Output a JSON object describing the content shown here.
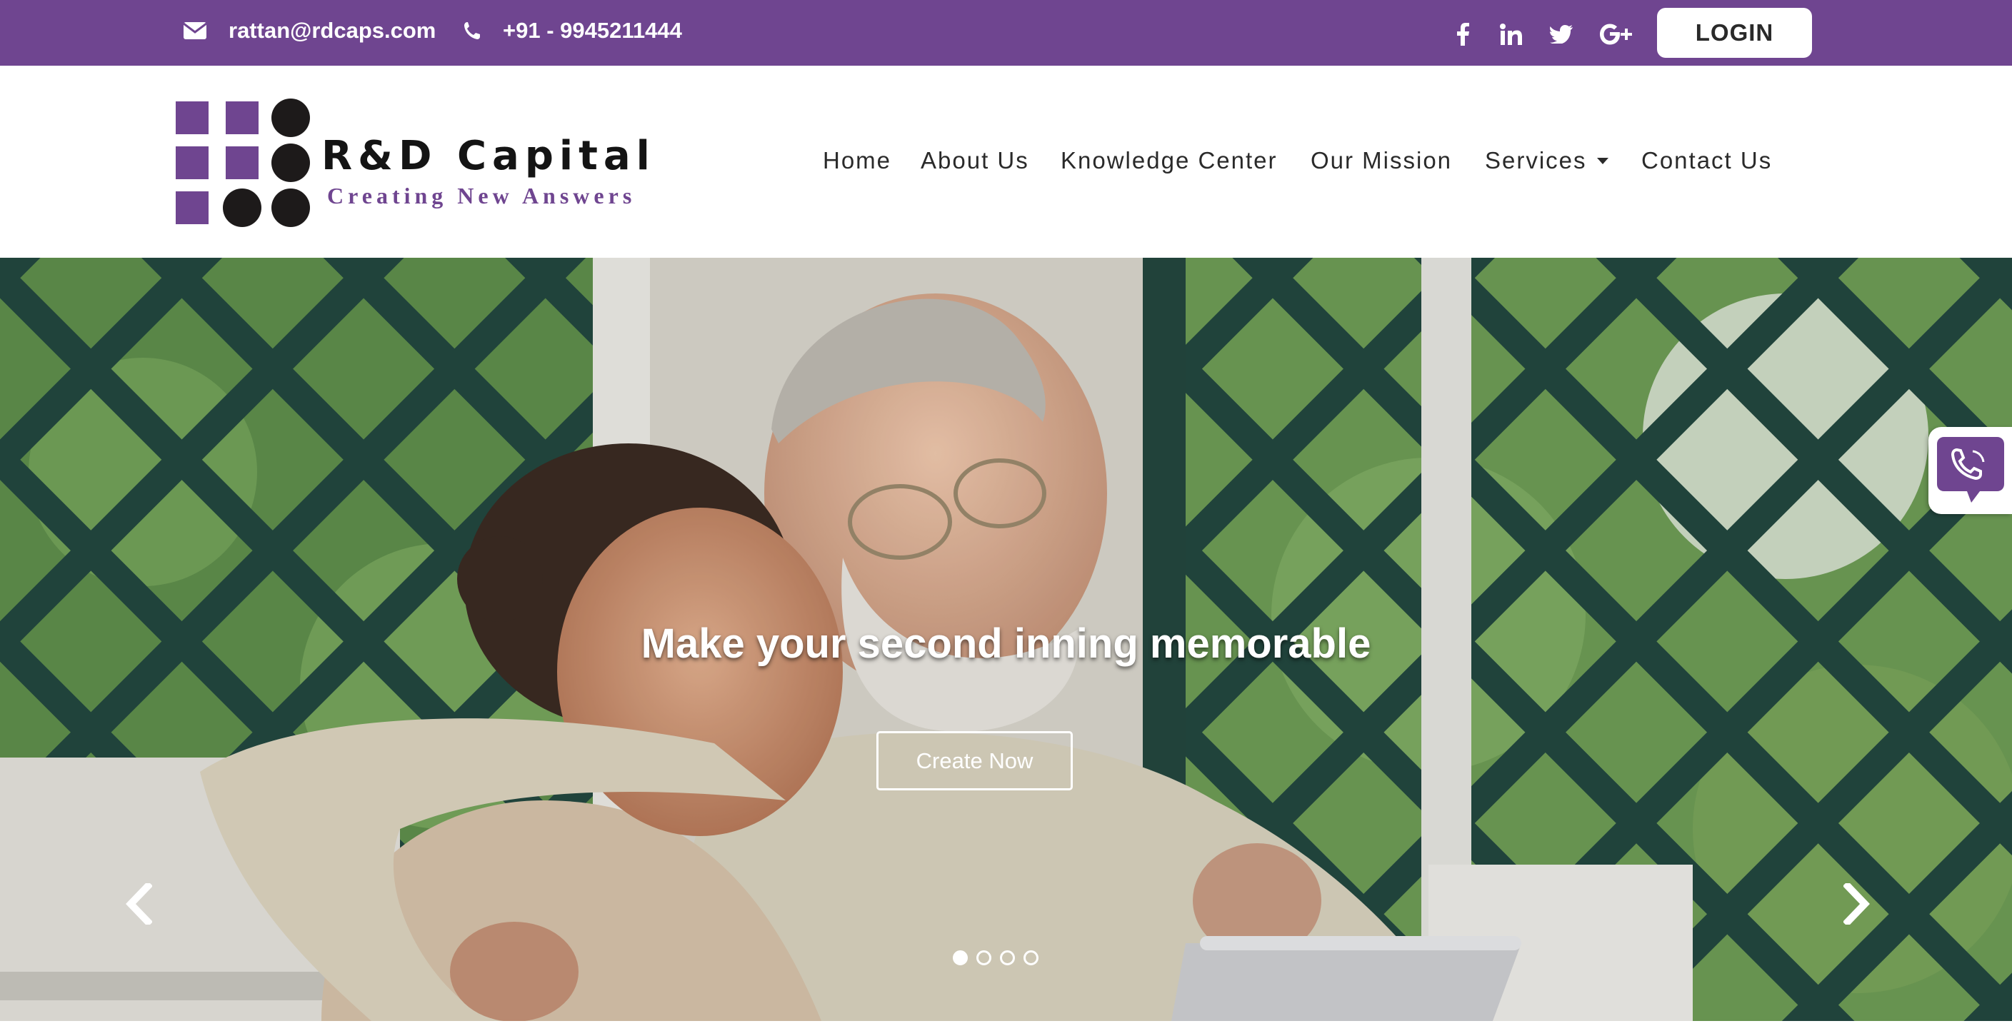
{
  "topbar": {
    "email": "rattan@rdcaps.com",
    "phone": "+91 - 9945211444",
    "social": [
      {
        "name": "facebook-icon",
        "glyph": "f"
      },
      {
        "name": "linkedin-icon",
        "glyph": "in"
      },
      {
        "name": "twitter-icon",
        "glyph": "bird"
      },
      {
        "name": "google-plus-icon",
        "glyph": "G+"
      }
    ],
    "login_label": "LOGIN"
  },
  "logo": {
    "name": "R&D Capital",
    "tagline": "Creating New Answers"
  },
  "nav": {
    "home": "Home",
    "about": "About Us",
    "knowledge": "Knowledge Center",
    "mission": "Our Mission",
    "services": "Services",
    "contact": "Contact Us"
  },
  "hero": {
    "headline": "Make your second inning memorable",
    "cta_label": "Create Now",
    "slide_count": 4,
    "active_slide": 1
  },
  "colors": {
    "brand_purple": "#6f4590",
    "dark": "#1d1a1a",
    "white": "#ffffff"
  },
  "widgets": {
    "call_icon": "phone-chat-icon"
  }
}
